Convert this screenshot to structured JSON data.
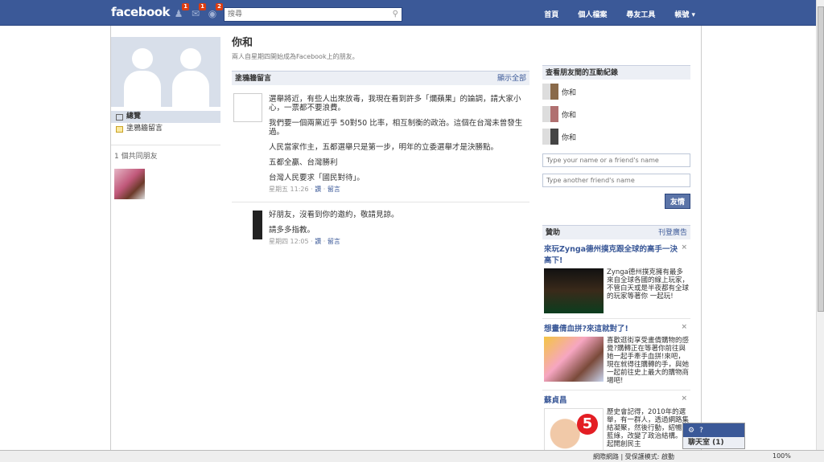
{
  "topbar": {
    "logo": "facebook",
    "notifications": [
      {
        "icon": "friend-requests-icon",
        "count": "1"
      },
      {
        "icon": "messages-icon",
        "count": "1"
      },
      {
        "icon": "notifications-globe-icon",
        "count": "2"
      }
    ],
    "search_placeholder": "搜尋",
    "nav": [
      "首頁",
      "個人檔案",
      "尋友工具",
      "帳號 ▾"
    ]
  },
  "left": {
    "menu": [
      {
        "label": "總覽",
        "active": true
      },
      {
        "label": "塗鴉牆留言",
        "active": false
      }
    ],
    "mutual_friends_label": "1 個共同朋友"
  },
  "main": {
    "title": "你和",
    "subtitle": "兩人自星期四開始成為Facebook上的朋友。",
    "wall_header": "塗鴉牆留言",
    "show_all": "顯示全部",
    "posts": [
      {
        "paragraphs": [
          "選舉將近，有些人出來放毒，我現在看到許多「爛蘋果」的論調，請大家小心，一票都不要浪費。",
          "我們要一個兩黨近乎 50對50 比率，相互制衡的政治。這個在台灣未曾發生過。",
          "人民當家作主，五都選舉只是第一步，明年的立委選舉才是決勝點。",
          "五都全贏、台灣勝利",
          "台灣人民要求「國民對待」。"
        ],
        "time": "星期五 11:26",
        "actions": [
          "讚",
          "留言"
        ]
      },
      {
        "paragraphs": [
          "好朋友，沒看到你的邀約，敬請見諒。",
          "請多多指教。"
        ],
        "time": "星期四 12:05",
        "actions": [
          "讚",
          "留言"
        ]
      }
    ]
  },
  "right": {
    "interactions_header": "查看朋友間的互動紀錄",
    "interactions": [
      "你和",
      "你和",
      "你和"
    ],
    "input1_placeholder": "Type your name or a friend's name",
    "input2_placeholder": "Type another friend's name",
    "friends_button": "友情",
    "sponsored_header": "贊助",
    "create_ad": "刊登廣告",
    "ads": [
      {
        "title": "來玩Zynga德州撲克跟全球的高手一決高下!",
        "text": "Zynga德州撲克擁有最多來自全球各國的線上玩家，不管白天或是半夜都有全球的玩家等著你 一起玩!"
      },
      {
        "title": "想畫倩血拼?來這就對了!",
        "text": "喜歡逛街享受畫倩購物的感覺?購轉正在等著你前往與她一起手牽手血拼!來吧，現在就得往購轉的手，與她一起前往史上最大的購物商場吧!"
      },
      {
        "title": "蘇貞昌",
        "text": "歷史會記得，2010年的選舉，有一群人，透過網路集結凝聚，然後行動，紹暢了藍綠，改變了政治結構。一起開創民主"
      }
    ]
  },
  "chat": {
    "label": "聊天室 (1)"
  },
  "statusbar": {
    "zone": "網際網路 | 受保護模式: 啟動",
    "zoom": "100%"
  }
}
